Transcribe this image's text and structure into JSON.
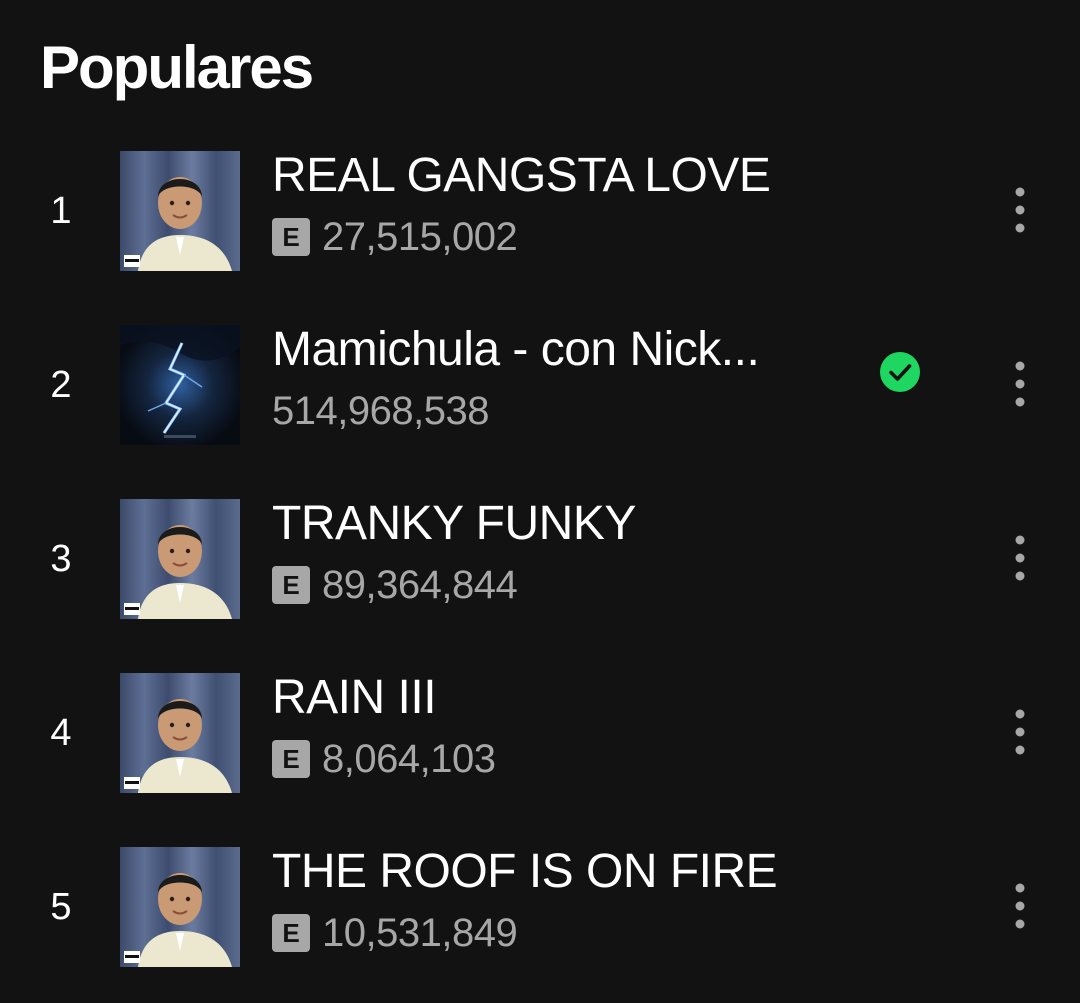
{
  "section": {
    "title": "Populares"
  },
  "colors": {
    "background": "#121212",
    "text_primary": "#ffffff",
    "text_secondary": "#a7a7a7",
    "saved_green": "#1ed760"
  },
  "tracks": [
    {
      "rank": "1",
      "title": "REAL GANGSTA LOVE",
      "explicit": true,
      "explicit_label": "E",
      "plays": "27,515,002",
      "saved": false,
      "cover": "portrait-cover"
    },
    {
      "rank": "2",
      "title": "Mamichula - con Nick...",
      "explicit": false,
      "plays": "514,968,538",
      "saved": true,
      "cover": "lightning-cover"
    },
    {
      "rank": "3",
      "title": "TRANKY FUNKY",
      "explicit": true,
      "explicit_label": "E",
      "plays": "89,364,844",
      "saved": false,
      "cover": "portrait-cover"
    },
    {
      "rank": "4",
      "title": "RAIN III",
      "explicit": true,
      "explicit_label": "E",
      "plays": "8,064,103",
      "saved": false,
      "cover": "portrait-cover"
    },
    {
      "rank": "5",
      "title": "THE ROOF IS ON FIRE",
      "explicit": true,
      "explicit_label": "E",
      "plays": "10,531,849",
      "saved": false,
      "cover": "portrait-cover"
    }
  ],
  "icons": {
    "saved": "check-circle-icon",
    "more": "more-vertical-icon"
  }
}
